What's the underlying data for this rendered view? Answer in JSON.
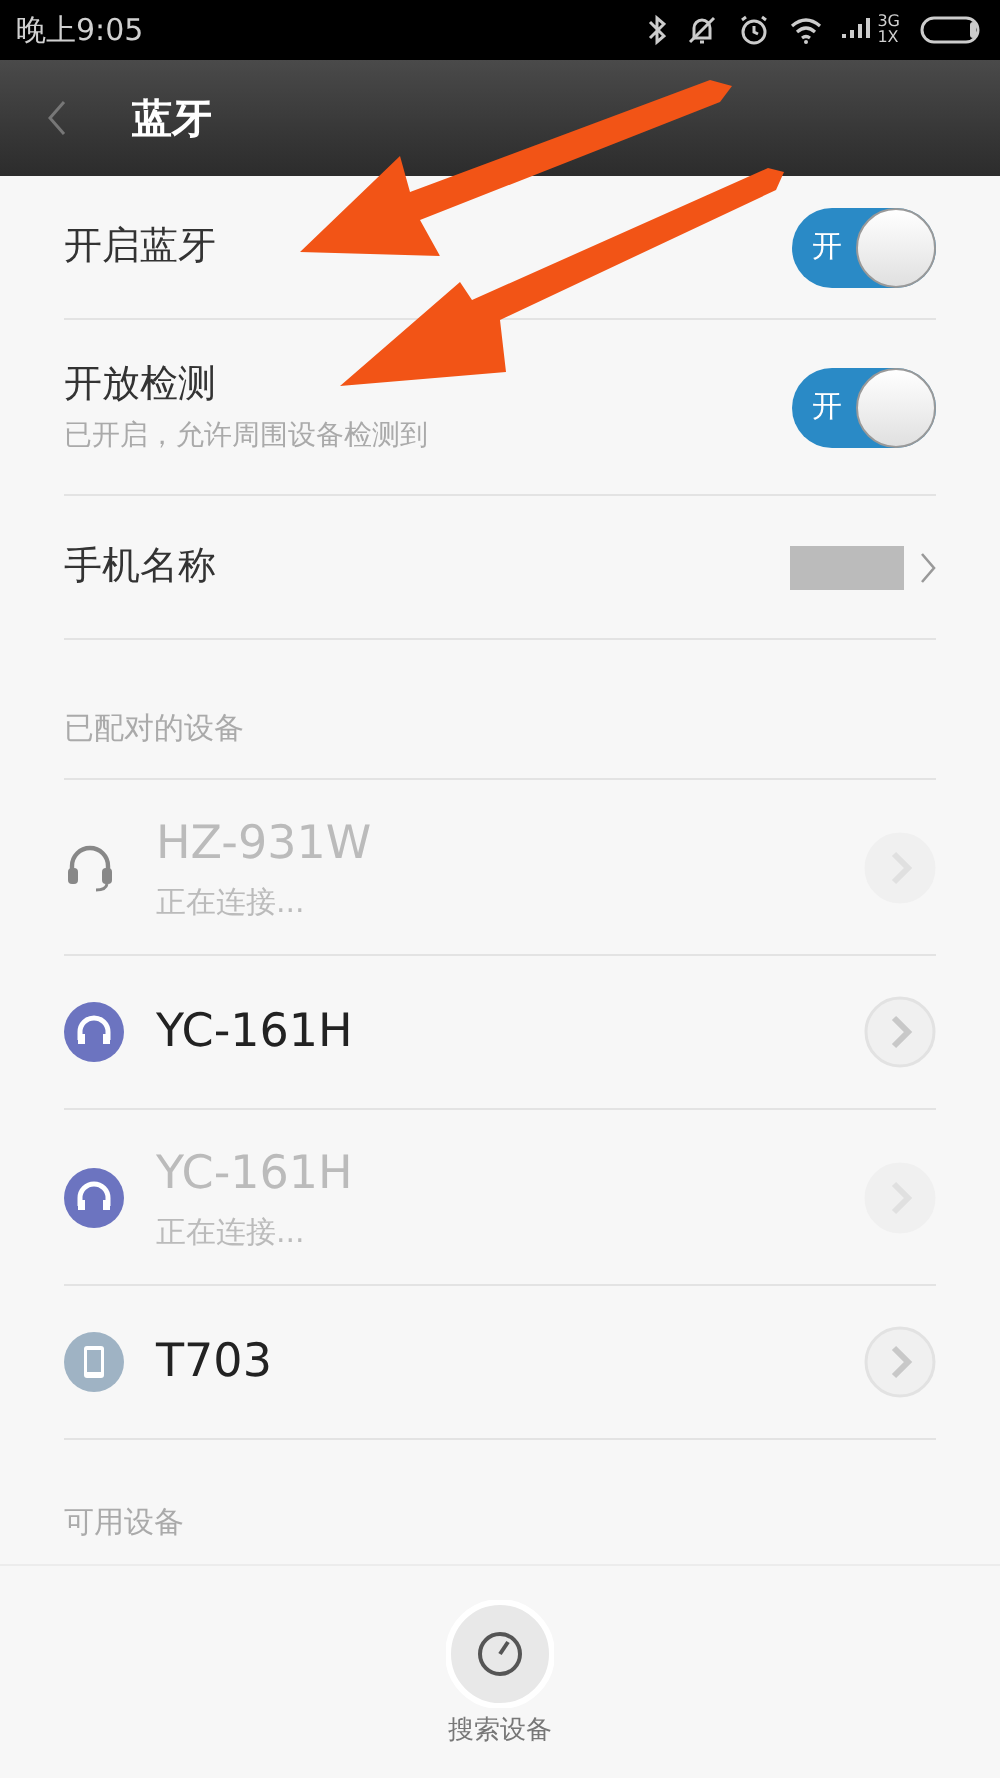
{
  "status_bar": {
    "time": "晚上9:05",
    "network": "3G",
    "network_sub": "1X"
  },
  "header": {
    "title": "蓝牙"
  },
  "settings": [
    {
      "kind": "toggle",
      "label": "开启蓝牙",
      "on": true,
      "toggle_text": "开"
    },
    {
      "kind": "toggle",
      "label": "开放检测",
      "subtitle": "已开启，允许周围设备检测到",
      "on": true,
      "toggle_text": "开"
    },
    {
      "kind": "link",
      "label": "手机名称"
    }
  ],
  "paired_header": "已配对的设备",
  "paired_devices": [
    {
      "kind": "headset",
      "name": "HZ-931W",
      "status": "正在连接...",
      "disabled": true
    },
    {
      "kind": "headphones",
      "name": "YC-161H",
      "disabled": false
    },
    {
      "kind": "headphones",
      "name": "YC-161H",
      "status": "正在连接...",
      "disabled": true
    },
    {
      "kind": "phone",
      "name": "T703",
      "disabled": false
    }
  ],
  "available_header": "可用设备",
  "search_button": {
    "label": "搜索设备"
  }
}
